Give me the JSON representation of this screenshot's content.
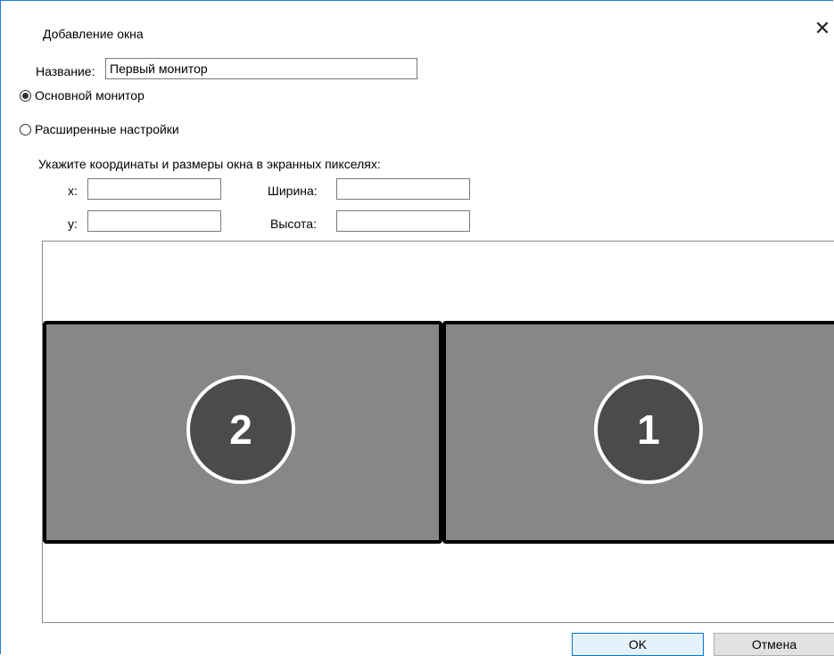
{
  "dialog": {
    "title": "Добавление окна",
    "close_glyph": "✕"
  },
  "name_field": {
    "label": "Название:",
    "value": "Первый монитор"
  },
  "options": {
    "primary_monitor": {
      "label": "Основной монитор",
      "selected": true
    },
    "advanced_settings": {
      "label": "Расширенные настройки",
      "selected": false
    }
  },
  "coords": {
    "hint": "Укажите координаты и размеры окна в экранных пикселях:",
    "x_label": "x:",
    "y_label": "y:",
    "width_label": "Ширина:",
    "height_label": "Высота:",
    "x_value": "",
    "y_value": "",
    "width_value": "",
    "height_value": ""
  },
  "monitors": [
    {
      "number": "2"
    },
    {
      "number": "1"
    }
  ],
  "buttons": {
    "ok": "OK",
    "cancel": "Отмена"
  }
}
